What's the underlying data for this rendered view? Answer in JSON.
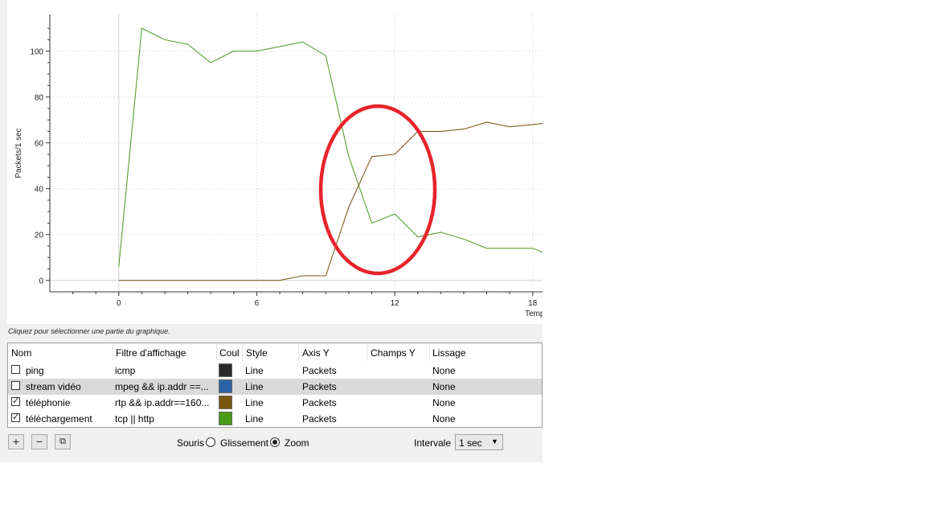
{
  "chart_data": {
    "type": "line",
    "xlabel": "Temp",
    "ylabel": "Packets/1 sec",
    "xlim": [
      -3,
      18.5
    ],
    "ylim": [
      -5,
      116
    ],
    "x_ticks": [
      "0",
      "6",
      "12",
      "18"
    ],
    "y_ticks": [
      "0",
      "20",
      "40",
      "60",
      "80",
      "100"
    ],
    "grid": true,
    "series": [
      {
        "name": "téléchargement",
        "color": "#5a9e2f",
        "x": [
          0,
          1,
          2,
          3,
          4,
          5,
          6,
          7,
          8,
          9,
          10,
          11,
          12,
          13,
          14,
          15,
          16,
          17,
          18,
          18.5
        ],
        "y": [
          6,
          110,
          105,
          103,
          95,
          100,
          100,
          102,
          104,
          98,
          54,
          25,
          29,
          19,
          21,
          18,
          14,
          14,
          14,
          12
        ]
      },
      {
        "name": "téléphonie",
        "color": "#7a5c1e",
        "x": [
          0,
          1,
          2,
          3,
          4,
          5,
          6,
          7,
          8,
          9,
          10,
          11,
          12,
          13,
          14,
          15,
          16,
          17,
          18,
          18.5
        ],
        "y": [
          0,
          0,
          0,
          0,
          0,
          0,
          0,
          0,
          2,
          2,
          32,
          54,
          55,
          65,
          65,
          66,
          69,
          67,
          68,
          68.5
        ]
      }
    ]
  },
  "hint": "Cliquez pour sélectionner une partie du graphique.",
  "table": {
    "headers": [
      "Nom",
      "Filtre d'affichage",
      "Coul",
      "Style",
      "Axis Y",
      "Champs Y",
      "Lissage"
    ],
    "rows": [
      {
        "checked": false,
        "check_glyph": "",
        "name": "ping",
        "filter": "icmp",
        "color": "#2b2b2b",
        "style": "Line",
        "axis": "Packets",
        "field": "",
        "smoothing": "None"
      },
      {
        "checked": false,
        "check_glyph": "",
        "name": "stream vidéo",
        "filter": "mpeg && ip.addr ==...",
        "color": "#2a62a8",
        "style": "Line",
        "axis": "Packets",
        "field": "",
        "smoothing": "None"
      },
      {
        "checked": true,
        "check_glyph": "✓",
        "name": "téléphonie",
        "filter": "rtp && ip.addr==160...",
        "color": "#7a5510",
        "style": "Line",
        "axis": "Packets",
        "field": "",
        "smoothing": "None"
      },
      {
        "checked": true,
        "check_glyph": "✓",
        "name": "téléchargement",
        "filter": "tcp || http",
        "color": "#4a9a18",
        "style": "Line",
        "axis": "Packets",
        "field": "",
        "smoothing": "None"
      }
    ]
  },
  "toolbar": {
    "add": "+",
    "remove": "−",
    "copy": "⧉",
    "mouse_label": "Souris",
    "drag_label": "Glissement",
    "zoom_label": "Zoom",
    "mouse_mode": "zoom",
    "interval_label": "Intervale",
    "interval_value": "1 sec",
    "interval_arrow": "▼"
  },
  "annotation": {
    "color": "#e8232a"
  }
}
